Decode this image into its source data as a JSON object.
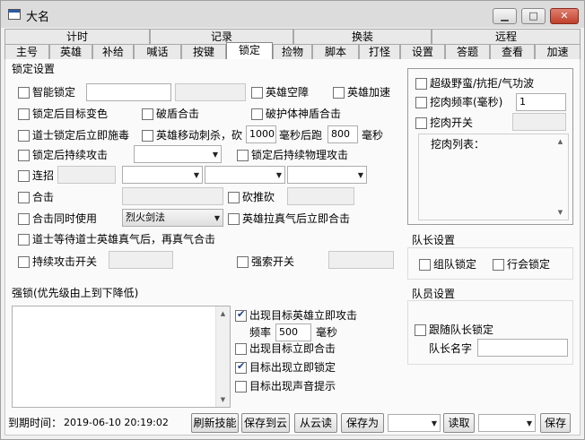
{
  "window": {
    "title": "大名",
    "icons": [
      "app-window-icon",
      "minimize-icon",
      "maximize-icon",
      "close-icon"
    ],
    "close_glyph": "✕",
    "min_glyph": "▁",
    "max_glyph": "□"
  },
  "tab_groups": [
    "计时",
    "记录",
    "换装",
    "远程"
  ],
  "tabs": [
    "主号",
    "英雄",
    "补给",
    "喊话",
    "按键",
    "锁定",
    "捡物",
    "脚本",
    "打怪",
    "设置",
    "答题",
    "查看",
    "加速"
  ],
  "active_tab": "锁定",
  "lock_settings": {
    "title": "锁定设置",
    "smart_lock": "智能锁定",
    "hero_empty_cleave": "英雄空障",
    "hero_speedup": "英雄加速",
    "lock_target_color": "锁定后目标变色",
    "shield_hit": "破盾合击",
    "guard_shield_hit": "破护体神盾合击",
    "taoist_poison": "道士锁定后立即施毒",
    "hero_move_kill": "英雄移动刺杀，砍",
    "kill_ms_value": "1000",
    "after_run_label": "毫秒后跑",
    "run_ms_value": "800",
    "ms_unit": "毫秒",
    "keep_attack": "锁定后持续攻击",
    "keep_physical": "锁定后持续物理攻击",
    "combo": "连招",
    "combined_attack": "合击",
    "hack_push": "砍推砍",
    "combined_with": "合击同时使用",
    "skill_select": "烈火剑法",
    "hero_pull_combine": "英雄拉真气后立即合击",
    "taoist_wait_qi": "道士等待道士英雄真气后，再真气合击",
    "sustain_attack_switch": "持续攻击开关",
    "force_search_switch": "强索开关"
  },
  "strong_lock": {
    "title": "强锁(优先级由上到下降低)",
    "hero_appear_attack": "出现目标英雄立即攻击",
    "hero_appear_attack_checked": true,
    "freq_label": "频率",
    "freq_value": "500",
    "freq_unit": "毫秒",
    "target_appear_combine": "出现目标立即合击",
    "target_appear_combine_checked": false,
    "target_appear_lock": "目标出现立即锁定",
    "target_appear_lock_checked": true,
    "target_appear_sound": "目标出现声音提示",
    "target_appear_sound_checked": false
  },
  "right_panel": {
    "super_savage": "超级野蛮/抗拒/气功波",
    "dig_freq": "挖肉频率(毫秒)",
    "dig_freq_value": "1",
    "dig_switch": "挖肉开关",
    "dig_list": "挖肉列表："
  },
  "captain": {
    "title": "队长设置",
    "group_lock": "组队锁定",
    "guild_lock": "行会锁定"
  },
  "member": {
    "title": "队员设置",
    "follow_lock": "跟随队长锁定",
    "captain_name": "队长名字"
  },
  "status": {
    "expire_label": "到期时间：",
    "expire_value": "2019-06-10 20:19:02",
    "refresh_skill": "刷新技能",
    "save_cloud": "保存到云",
    "load_cloud": "从云读",
    "save_as": "保存为",
    "read": "读取",
    "save": "保存"
  }
}
